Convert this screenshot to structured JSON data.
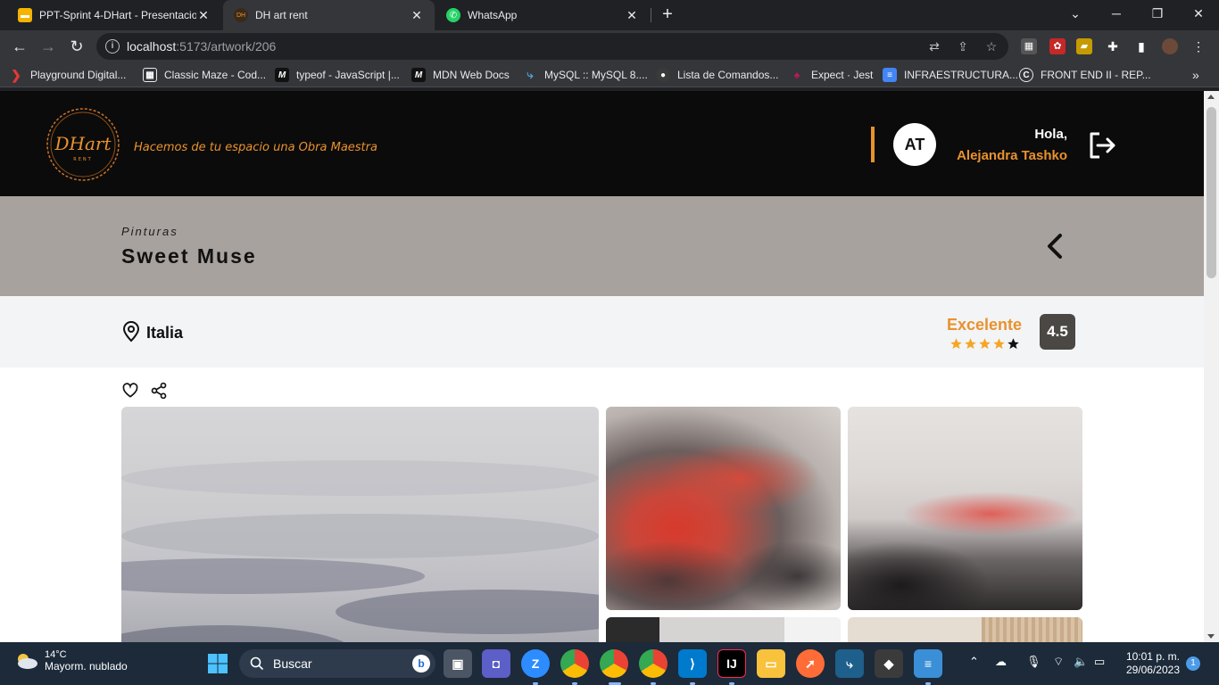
{
  "browser": {
    "tabs": [
      {
        "title": "PPT-Sprint 4-DHart - Presentacio",
        "favicon": "slides-icon",
        "active": false
      },
      {
        "title": "DH art rent",
        "favicon": "dhart-icon",
        "active": true
      },
      {
        "title": "WhatsApp",
        "favicon": "whatsapp-icon",
        "active": false
      }
    ],
    "url_host": "localhost",
    "url_path": ":5173/artwork/206",
    "bookmarks": [
      "Playground Digital...",
      "Classic Maze - Cod...",
      "typeof - JavaScript |...",
      "MDN Web Docs",
      "MySQL :: MySQL 8....",
      "Lista de Comandos...",
      "Expect · Jest",
      "INFRAESTRUCTURA...",
      "FRONT END II - REP..."
    ]
  },
  "header": {
    "logo_text": "DHart",
    "logo_sub": "RENT",
    "tagline": "Hacemos de tu espacio una Obra Maestra",
    "avatar_initials": "AT",
    "greeting": "Hola,",
    "user_name": "Alejandra Tashko"
  },
  "artwork": {
    "category": "Pinturas",
    "title": "Sweet Muse",
    "location": "Italia",
    "rating_label": "Excelente",
    "rating_score": "4.5",
    "stars_filled": 4,
    "stars_total": 5
  },
  "colors": {
    "accent": "#e8922e",
    "header_bg": "#0c0b0b",
    "title_band": "#a8a29e",
    "info_band": "#f3f4f6",
    "score_bg": "#4a4744"
  },
  "taskbar": {
    "weather_temp": "14°C",
    "weather_desc": "Mayorm. nublado",
    "search_label": "Buscar",
    "time": "10:01 p. m.",
    "date": "29/06/2023",
    "notifications": "1"
  }
}
